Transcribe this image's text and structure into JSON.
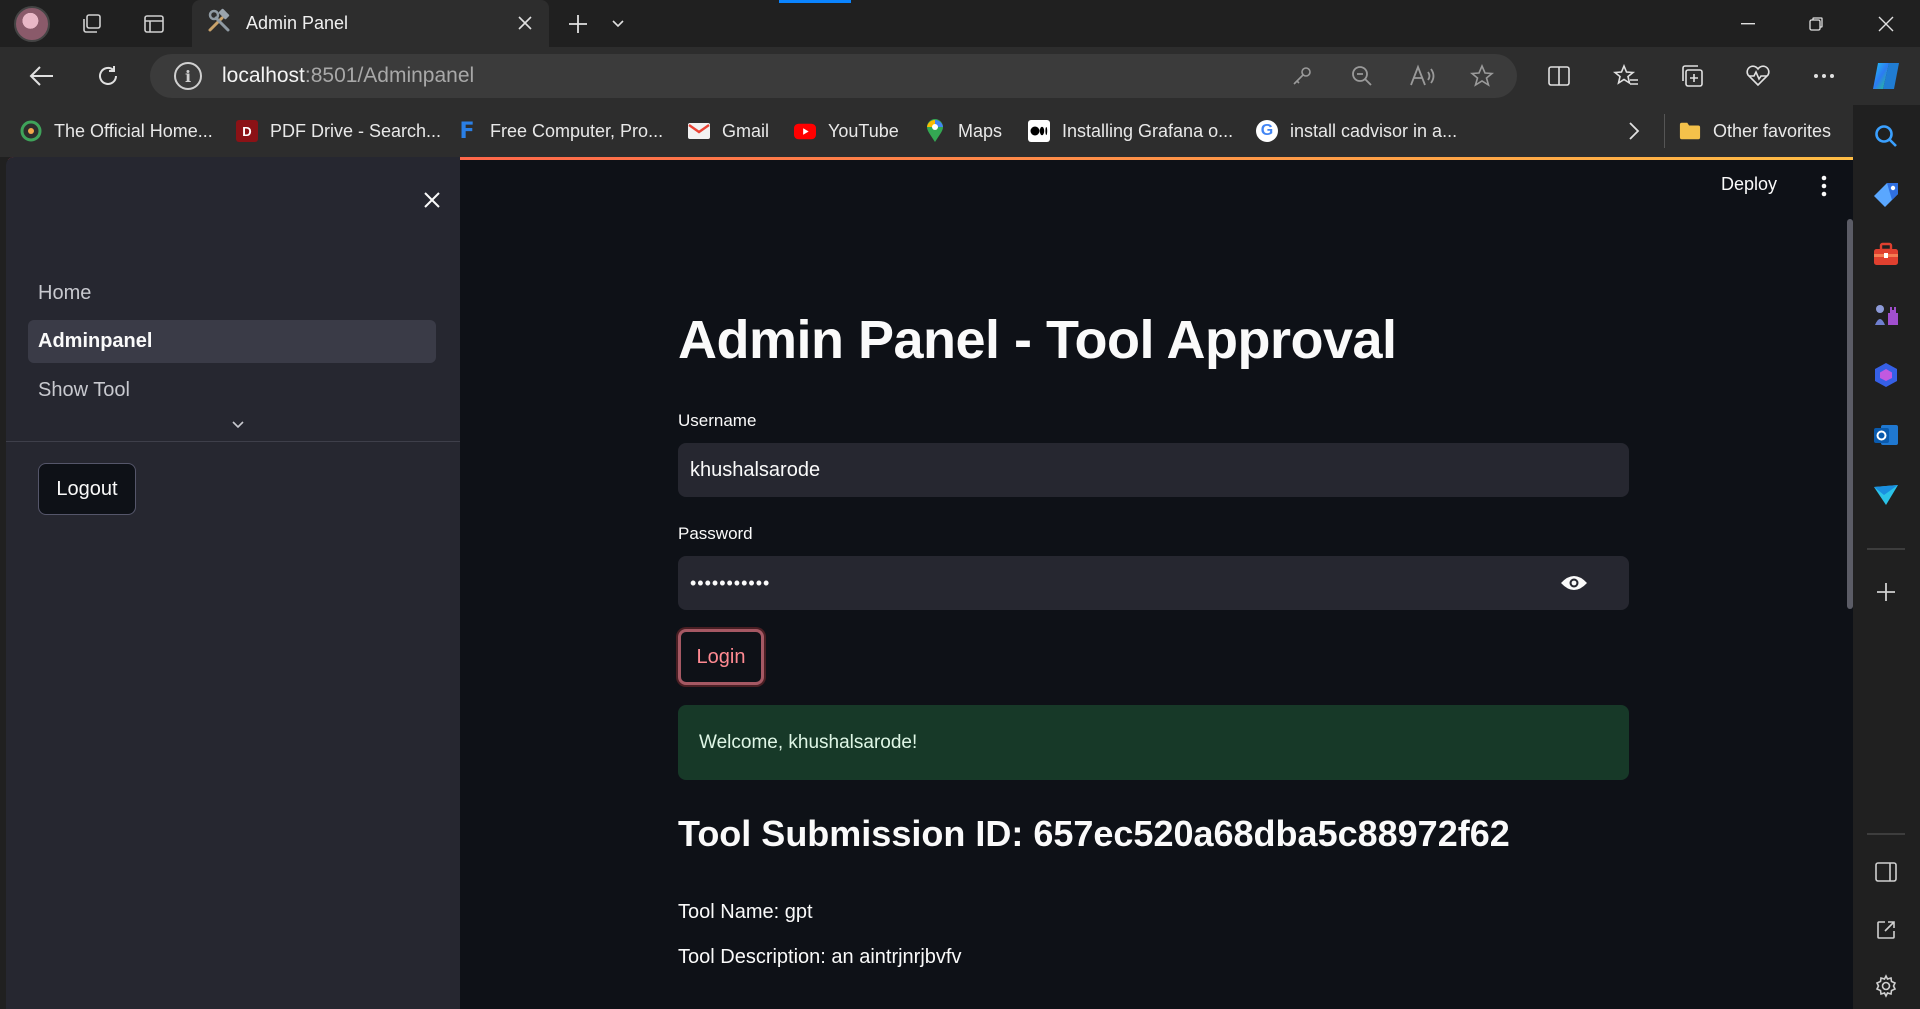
{
  "browser": {
    "tab": {
      "title": "Admin Panel",
      "icon": "hammer-wrench-icon"
    },
    "address": {
      "host": "localhost",
      "path": ":8501/Adminpanel"
    },
    "favorites": [
      {
        "label": "The Official Home...",
        "icon": "grafana-logo-icon",
        "color": "#2e8b57"
      },
      {
        "label": "PDF Drive - Search...",
        "icon": "pdfdrive-icon",
        "color": "#b5171b"
      },
      {
        "label": "Free Computer, Pro...",
        "icon": "f-logo-icon",
        "color": "#1a73e8"
      },
      {
        "label": "Gmail",
        "icon": "gmail-icon",
        "color": "#ea4335"
      },
      {
        "label": "YouTube",
        "icon": "youtube-icon",
        "color": "#ff0000"
      },
      {
        "label": "Maps",
        "icon": "maps-icon",
        "color": "#34a853"
      },
      {
        "label": "Installing Grafana o...",
        "icon": "medium-icon",
        "color": "#ffffff"
      },
      {
        "label": "install cadvisor in a...",
        "icon": "google-icon",
        "color": "#4285f4"
      }
    ],
    "other_favorites": "Other favorites"
  },
  "app": {
    "deploy_label": "Deploy",
    "sidebar": {
      "items": [
        {
          "label": "Home"
        },
        {
          "label": "Adminpanel"
        },
        {
          "label": "Show Tool"
        }
      ],
      "logout_label": "Logout"
    },
    "main": {
      "title": "Admin Panel - Tool Approval",
      "username_label": "Username",
      "username_value": "khushalsarode",
      "password_label": "Password",
      "password_mask": "•••••••••••",
      "login_label": "Login",
      "welcome_message": "Welcome, khushalsarode!",
      "submission_heading": "Tool Submission ID: 657ec520a68dba5c88972f62",
      "tool_name": "Tool Name: gpt",
      "tool_description": "Tool Description: an aintrjnrjbvfv"
    }
  },
  "colors": {
    "accent": "#ff4b4b",
    "success_bg": "#173928",
    "sidebar_bg": "#262730",
    "page_bg": "#0e1117"
  }
}
